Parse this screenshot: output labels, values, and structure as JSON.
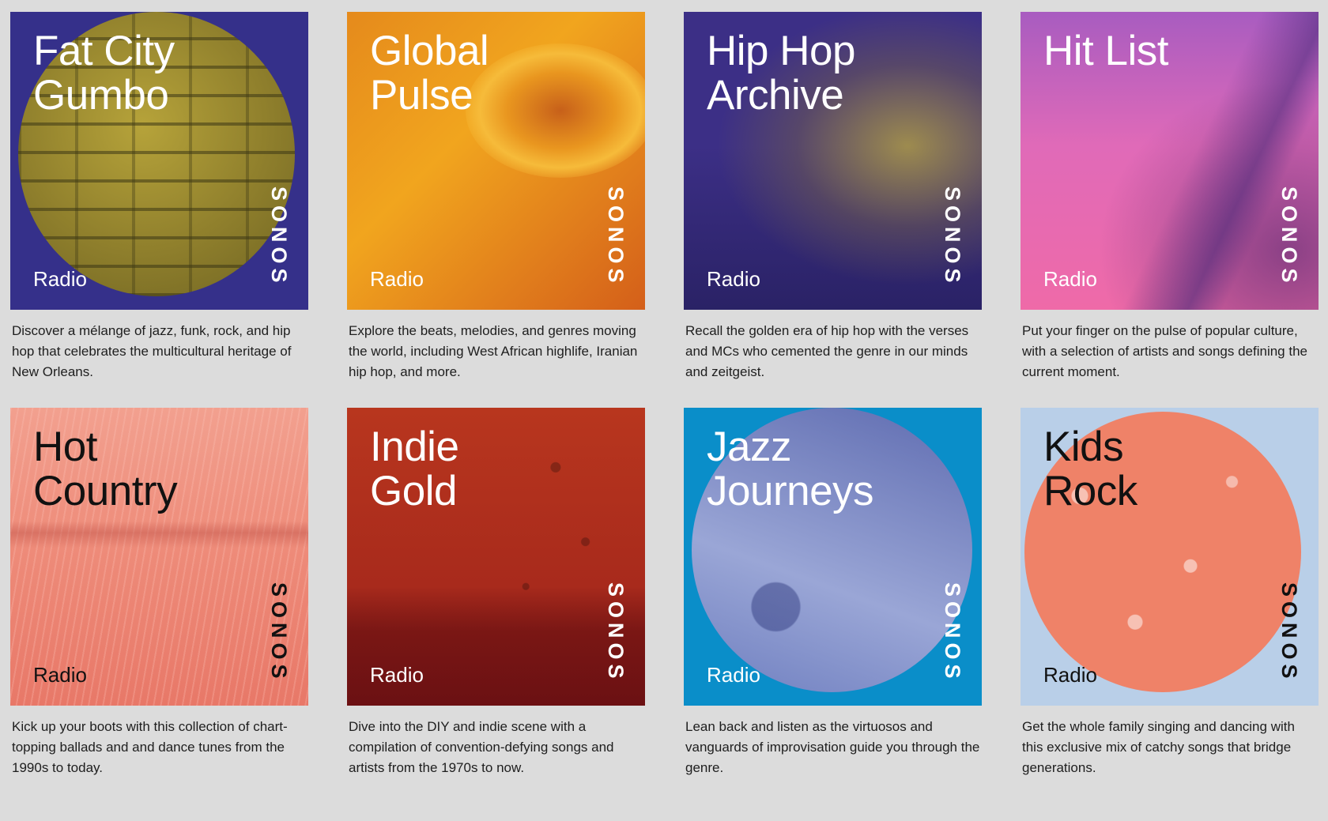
{
  "stations": [
    {
      "title": "Fat City\nGumbo",
      "label": "Radio",
      "brand": "SONOS",
      "description": "Discover a mélange of jazz, funk, rock, and hip hop that celebrates the multicultural heritage of New Orleans.",
      "color": "#35308a"
    },
    {
      "title": "Global\nPulse",
      "label": "Radio",
      "brand": "SONOS",
      "description": "Explore the beats, melodies, and genres moving the world, including West African highlife, Iranian hip hop, and more.",
      "color": "#ec9a1f"
    },
    {
      "title": "Hip Hop\nArchive",
      "label": "Radio",
      "brand": "SONOS",
      "description": "Recall the golden era of hip hop with the verses and MCs who cemented the genre in our minds and zeitgeist.",
      "color": "#3c2f86"
    },
    {
      "title": "Hit List",
      "label": "Radio",
      "brand": "SONOS",
      "description": "Put your finger on the pulse of popular culture, with a selection of artists and songs defining the current moment.",
      "color": "#e06ab8"
    },
    {
      "title": "Hot\nCountry",
      "label": "Radio",
      "brand": "SONOS",
      "description": "Kick up your boots with this collection of chart-topping ballads and and dance tunes from the 1990s to today.",
      "color": "#ee8c7a"
    },
    {
      "title": "Indie\nGold",
      "label": "Radio",
      "brand": "SONOS",
      "description": "Dive into the DIY and indie scene with a compilation of convention-defying songs and artists from the 1970s to now.",
      "color": "#a82a1c"
    },
    {
      "title": "Jazz\nJourneys",
      "label": "Radio",
      "brand": "SONOS",
      "description": "Lean back and listen as the virtuosos and vanguards of improvisation guide you through the genre.",
      "color": "#0a8ec9"
    },
    {
      "title": "Kids\nRock",
      "label": "Radio",
      "brand": "SONOS",
      "description": "Get the whole family singing and dancing with this exclusive mix of catchy songs that bridge generations.",
      "color": "#b9cfe8"
    }
  ]
}
